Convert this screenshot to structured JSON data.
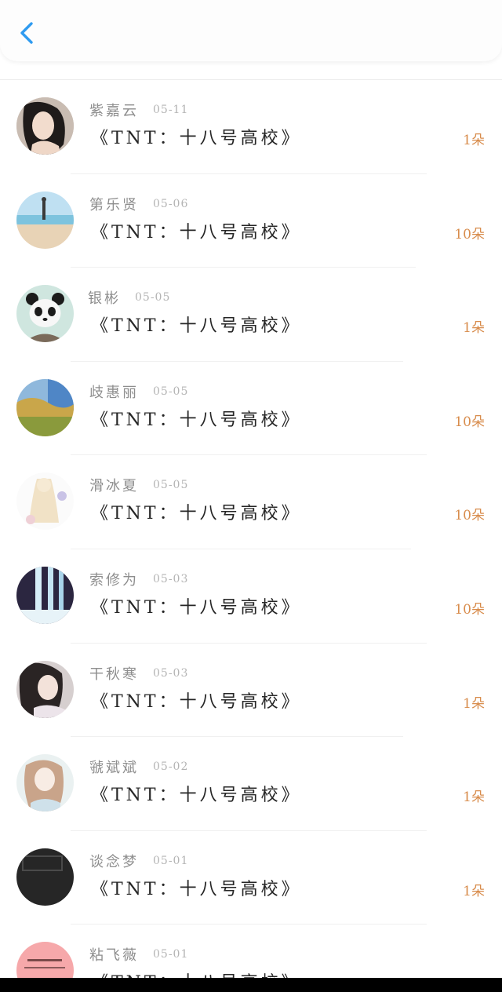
{
  "header": {
    "back_icon": "chevron-left-icon",
    "accent": "#2f9bf0"
  },
  "items": [
    {
      "name": "紫嘉云",
      "date": "05-11",
      "title": "《TNT：十八号高校》",
      "amount": "1朵",
      "avatar": "portrait-photo"
    },
    {
      "name": "第乐贤",
      "date": "05-06",
      "title": "《TNT：十八号高校》",
      "amount": "10朵",
      "avatar": "beach-photo"
    },
    {
      "name": "银彬",
      "date": "05-05",
      "title": "《TNT：十八号高校》",
      "amount": "1朵",
      "avatar": "panda-photo"
    },
    {
      "name": "歧惠丽",
      "date": "05-05",
      "title": "《TNT：十八号高校》",
      "amount": "10朵",
      "avatar": "landscape-photo"
    },
    {
      "name": "滑冰夏",
      "date": "05-05",
      "title": "《TNT：十八号高校》",
      "amount": "10朵",
      "avatar": "illustration-flowers"
    },
    {
      "name": "索修为",
      "date": "05-03",
      "title": "《TNT：十八号高校》",
      "amount": "10朵",
      "avatar": "waterfall-photo"
    },
    {
      "name": "干秋寒",
      "date": "05-03",
      "title": "《TNT：十八号高校》",
      "amount": "1朵",
      "avatar": "portrait-photo"
    },
    {
      "name": "虢斌斌",
      "date": "05-02",
      "title": "《TNT：十八号高校》",
      "amount": "1朵",
      "avatar": "anime-girl-illustration"
    },
    {
      "name": "谈念梦",
      "date": "05-01",
      "title": "《TNT：十八号高校》",
      "amount": "1朵",
      "avatar": "dark-image-placeholder"
    },
    {
      "name": "粘飞薇",
      "date": "05-01",
      "title": "《TNT：十八号高校》",
      "amount": "",
      "avatar": "pink-text-card"
    }
  ],
  "colors": {
    "name": "#8e8e8e",
    "date": "#b4b4b4",
    "title": "#262626",
    "amount": "#d88c4c"
  }
}
